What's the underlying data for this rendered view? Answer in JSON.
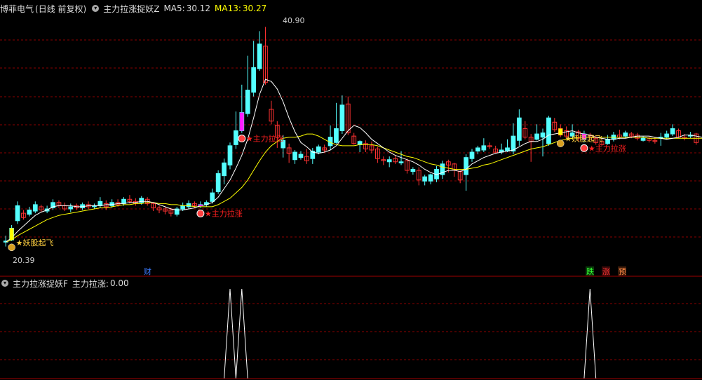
{
  "main_panel": {
    "stock_name": "博菲电气",
    "period_label": "(日线 前复权)",
    "indicator_name": "主力拉涨捉妖Z",
    "ma5_label": "MA5:",
    "ma5_value": "30.12",
    "ma13_label": "MA13:",
    "ma13_value": "30.27",
    "high_price_label": "40.90",
    "low_price_label": "20.39",
    "signal_labels": {
      "yaogu": "妖股起飞",
      "zhuli": "主力拉涨"
    },
    "markers": {
      "cai": "财",
      "die": "跌",
      "zhang": "涨",
      "yu": "预"
    }
  },
  "sub_panel": {
    "indicator_name": "主力拉涨捉妖F",
    "value_label": "主力拉涨:",
    "value": "0.00"
  },
  "colors": {
    "background": "#000000",
    "up": "#ff3232",
    "down": "#54ffff",
    "ma5": "#ffffff",
    "ma13": "#ffff00",
    "grid": "#8b0000",
    "signal_bar": "#ff1cff",
    "yaogu_bar": "#ffff00"
  },
  "chart_data": {
    "type": "candlestick",
    "y_range": [
      18.4,
      42.1
    ],
    "high": 40.9,
    "low": 20.39,
    "candles": [
      [
        20.9,
        20.8,
        21.4,
        20.39
      ],
      [
        22.1,
        21.0,
        22.4,
        20.9
      ],
      [
        24.2,
        22.8,
        24.6,
        22.5
      ],
      [
        23.1,
        23.5,
        23.8,
        22.9
      ],
      [
        23.8,
        23.4,
        24.1,
        23.2
      ],
      [
        24.3,
        23.7,
        24.6,
        23.5
      ],
      [
        23.8,
        24.1,
        24.3,
        23.6
      ],
      [
        23.9,
        23.7,
        24.2,
        23.5
      ],
      [
        24.5,
        24.0,
        24.8,
        23.8
      ],
      [
        24.2,
        24.5,
        24.7,
        24.0
      ],
      [
        23.9,
        24.2,
        24.5,
        23.7
      ],
      [
        24.1,
        23.9,
        24.4,
        23.6
      ],
      [
        24.0,
        24.2,
        24.4,
        23.8
      ],
      [
        24.3,
        24.0,
        24.5,
        23.8
      ],
      [
        24.1,
        24.3,
        24.6,
        23.9
      ],
      [
        24.2,
        24.1,
        24.4,
        23.9
      ],
      [
        24.6,
        24.2,
        25.0,
        24.0
      ],
      [
        24.1,
        24.4,
        24.7,
        23.8
      ],
      [
        24.5,
        24.2,
        24.8,
        24.0
      ],
      [
        24.3,
        24.5,
        24.8,
        24.1
      ],
      [
        24.8,
        24.4,
        25.0,
        24.2
      ],
      [
        24.6,
        24.8,
        25.2,
        24.4
      ],
      [
        24.4,
        24.6,
        24.9,
        24.2
      ],
      [
        24.9,
        24.5,
        25.1,
        24.3
      ],
      [
        24.4,
        24.8,
        25.0,
        24.2
      ],
      [
        24.0,
        24.4,
        24.5,
        23.7
      ],
      [
        23.8,
        24.0,
        24.2,
        23.5
      ],
      [
        23.7,
        23.9,
        24.1,
        23.4
      ],
      [
        23.5,
        23.8,
        24.0,
        23.2
      ],
      [
        23.9,
        23.4,
        24.1,
        23.2
      ],
      [
        24.2,
        23.9,
        24.5,
        23.7
      ],
      [
        24.4,
        24.1,
        24.7,
        23.9
      ],
      [
        24.2,
        24.4,
        24.6,
        24.0
      ],
      [
        24.3,
        24.2,
        24.6,
        24.0
      ],
      [
        24.5,
        24.3,
        24.7,
        24.1
      ],
      [
        25.4,
        24.6,
        25.8,
        24.4
      ],
      [
        27.2,
        25.5,
        27.5,
        25.3
      ],
      [
        28.2,
        27.0,
        28.6,
        26.2
      ],
      [
        29.8,
        28.0,
        30.1,
        27.6
      ],
      [
        31.2,
        29.9,
        33.0,
        29.5
      ],
      [
        32.9,
        31.2,
        35.5,
        31.0
      ],
      [
        35.0,
        32.8,
        38.2,
        32.5
      ],
      [
        37.1,
        34.8,
        39.6,
        34.4
      ],
      [
        39.3,
        37.0,
        40.5,
        36.8
      ],
      [
        35.7,
        39.1,
        40.9,
        35.5
      ],
      [
        32.1,
        33.2,
        34.0,
        31.8
      ],
      [
        30.6,
        31.7,
        32.1,
        29.6
      ],
      [
        30.3,
        29.6,
        30.8,
        28.7
      ],
      [
        29.1,
        29.6,
        30.0,
        28.2
      ],
      [
        29.2,
        28.5,
        29.4,
        28.1
      ],
      [
        29.0,
        28.7,
        29.3,
        28.5
      ],
      [
        28.4,
        28.8,
        29.5,
        28.1
      ],
      [
        29.3,
        28.6,
        29.6,
        28.1
      ],
      [
        29.7,
        29.2,
        29.9,
        29.0
      ],
      [
        29.4,
        29.6,
        29.9,
        29.2
      ],
      [
        30.6,
        29.8,
        31.7,
        29.4
      ],
      [
        31.4,
        30.1,
        33.8,
        30.0
      ],
      [
        33.6,
        31.2,
        34.5,
        30.9
      ],
      [
        31.0,
        33.7,
        34.4,
        30.8
      ],
      [
        30.0,
        30.7,
        31.0,
        29.9
      ],
      [
        30.2,
        29.9,
        30.3,
        29.2
      ],
      [
        29.5,
        30.0,
        30.3,
        29.2
      ],
      [
        29.4,
        29.8,
        30.2,
        29.1
      ],
      [
        28.6,
        29.5,
        29.7,
        28.2
      ],
      [
        28.4,
        28.5,
        28.8,
        28.0
      ],
      [
        28.5,
        28.3,
        28.8,
        27.8
      ],
      [
        28.3,
        28.6,
        28.9,
        28.1
      ],
      [
        28.3,
        28.2,
        29.3,
        28.0
      ],
      [
        27.5,
        28.4,
        28.6,
        27.2
      ],
      [
        27.6,
        27.4,
        27.8,
        27.1
      ],
      [
        26.6,
        27.5,
        27.8,
        26.1
      ],
      [
        26.9,
        26.5,
        27.1,
        26.1
      ],
      [
        27.1,
        26.5,
        27.2,
        26.2
      ],
      [
        27.6,
        26.7,
        27.9,
        26.4
      ],
      [
        28.1,
        27.1,
        28.4,
        26.7
      ],
      [
        28.0,
        28.3,
        28.5,
        27.3
      ],
      [
        27.5,
        28.1,
        28.2,
        26.9
      ],
      [
        26.6,
        27.4,
        27.5,
        26.3
      ],
      [
        28.7,
        27.1,
        29.0,
        25.6
      ],
      [
        29.2,
        28.6,
        29.5,
        28.3
      ],
      [
        29.6,
        29.3,
        29.8,
        29.0
      ],
      [
        29.8,
        29.4,
        30.5,
        29.2
      ],
      [
        29.7,
        29.8,
        30.1,
        29.5
      ],
      [
        29.2,
        29.5,
        29.8,
        29.1
      ],
      [
        29.4,
        29.2,
        30.0,
        29.0
      ],
      [
        29.6,
        29.3,
        30.4,
        29.2
      ],
      [
        30.7,
        29.3,
        31.9,
        29.0
      ],
      [
        32.4,
        30.3,
        33.2,
        29.8
      ],
      [
        30.6,
        31.4,
        32.1,
        30.4
      ],
      [
        30.2,
        30.6,
        30.9,
        28.3
      ],
      [
        30.9,
        30.4,
        31.8,
        30.3
      ],
      [
        31.0,
        30.6,
        31.4,
        28.8
      ],
      [
        32.4,
        30.0,
        32.6,
        29.8
      ],
      [
        31.3,
        32.0,
        32.4,
        31.1
      ],
      [
        30.8,
        31.4,
        31.8,
        30.6
      ],
      [
        30.7,
        31.2,
        31.6,
        30.5
      ],
      [
        31.0,
        30.7,
        31.8,
        30.4
      ],
      [
        30.5,
        31.1,
        31.3,
        30.2
      ],
      [
        30.9,
        30.4,
        31.2,
        30.1
      ],
      [
        30.6,
        30.8,
        31.0,
        30.4
      ],
      [
        30.1,
        30.5,
        30.7,
        29.9
      ],
      [
        29.9,
        30.2,
        30.4,
        29.8
      ],
      [
        30.4,
        30.0,
        30.8,
        29.9
      ],
      [
        30.8,
        30.4,
        31.1,
        30.2
      ],
      [
        30.6,
        30.8,
        31.3,
        30.4
      ],
      [
        31.0,
        30.7,
        31.2,
        30.5
      ],
      [
        30.7,
        30.9,
        31.1,
        30.5
      ],
      [
        30.5,
        30.8,
        31.0,
        30.3
      ],
      [
        30.5,
        30.3,
        30.7,
        30.2
      ],
      [
        30.3,
        30.5,
        30.7,
        30.1
      ],
      [
        30.2,
        30.3,
        30.6,
        30.0
      ],
      [
        30.6,
        30.5,
        31.0,
        29.8
      ],
      [
        30.9,
        30.6,
        31.2,
        30.4
      ],
      [
        31.4,
        30.9,
        31.8,
        30.7
      ],
      [
        30.6,
        31.2,
        31.4,
        30.5
      ],
      [
        30.5,
        30.6,
        30.9,
        30.3
      ],
      [
        30.8,
        30.7,
        31.1,
        30.5
      ],
      [
        30.1,
        30.9,
        31.0,
        29.9
      ]
    ],
    "ma5": [
      20.8,
      21.2,
      21.8,
      22.3,
      22.8,
      23.3,
      23.6,
      23.8,
      24.1,
      24.2,
      24.2,
      24.2,
      24.1,
      24.1,
      24.2,
      24.2,
      24.2,
      24.3,
      24.3,
      24.4,
      24.4,
      24.5,
      24.5,
      24.6,
      24.6,
      24.5,
      24.3,
      24.1,
      23.9,
      23.8,
      23.8,
      23.9,
      24.0,
      24.2,
      24.3,
      24.5,
      25.0,
      25.8,
      26.6,
      27.7,
      28.9,
      30.4,
      32.4,
      34.6,
      36.0,
      35.8,
      35.1,
      33.9,
      32.4,
      31.1,
      30.1,
      29.7,
      29.2,
      29.1,
      29.2,
      29.4,
      29.8,
      30.5,
      31.2,
      31.7,
      31.5,
      31.0,
      30.4,
      30.0,
      29.6,
      29.2,
      28.9,
      28.7,
      28.5,
      28.3,
      28.0,
      27.6,
      27.3,
      27.1,
      27.3,
      27.5,
      27.5,
      27.4,
      27.6,
      28.1,
      28.4,
      28.7,
      28.9,
      29.1,
      29.2,
      29.3,
      29.4,
      29.7,
      30.0,
      30.2,
      30.2,
      30.4,
      30.8,
      30.9,
      31.0,
      31.1,
      31.2,
      31.0,
      30.9,
      30.8,
      30.6,
      30.5,
      30.4,
      30.4,
      30.5,
      30.5,
      30.6,
      30.7,
      30.7,
      30.7,
      30.6,
      30.5,
      30.4,
      30.5,
      30.6,
      30.8,
      30.8,
      30.7,
      30.6,
      30.6
    ],
    "ma13": [
      20.8,
      21.0,
      21.4,
      21.7,
      22.0,
      22.3,
      22.6,
      22.9,
      23.1,
      23.3,
      23.4,
      23.5,
      23.6,
      23.7,
      23.8,
      23.9,
      24.0,
      24.0,
      24.1,
      24.2,
      24.3,
      24.3,
      24.4,
      24.4,
      24.5,
      24.5,
      24.4,
      24.4,
      24.3,
      24.3,
      24.2,
      24.2,
      24.1,
      24.1,
      24.1,
      24.1,
      24.3,
      24.6,
      24.9,
      25.4,
      25.9,
      26.6,
      27.5,
      28.4,
      29.2,
      29.8,
      30.2,
      30.5,
      30.6,
      30.6,
      30.7,
      30.9,
      30.9,
      30.7,
      30.4,
      30.1,
      29.9,
      29.8,
      29.8,
      29.8,
      29.9,
      29.9,
      29.9,
      29.8,
      29.6,
      29.4,
      29.2,
      29.0,
      28.8,
      28.7,
      28.5,
      28.3,
      28.1,
      28.0,
      27.8,
      27.7,
      27.6,
      27.6,
      27.6,
      27.7,
      27.8,
      28.0,
      28.1,
      28.3,
      28.5,
      28.7,
      28.9,
      29.1,
      29.3,
      29.5,
      29.6,
      29.7,
      29.9,
      30.1,
      30.3,
      30.4,
      30.5,
      30.6,
      30.6,
      30.6,
      30.6,
      30.6,
      30.6,
      30.6,
      30.6,
      30.6,
      30.6,
      30.6,
      30.6,
      30.5,
      30.5,
      30.5,
      30.5,
      30.5,
      30.5,
      30.5,
      30.5,
      30.5,
      30.5,
      30.5
    ],
    "signal_bars": [
      33,
      40,
      98
    ],
    "yaogu_bars": [
      1,
      94
    ],
    "sub_signal_peaks": [
      38,
      40,
      99
    ],
    "sub_range": [
      0,
      1
    ]
  }
}
